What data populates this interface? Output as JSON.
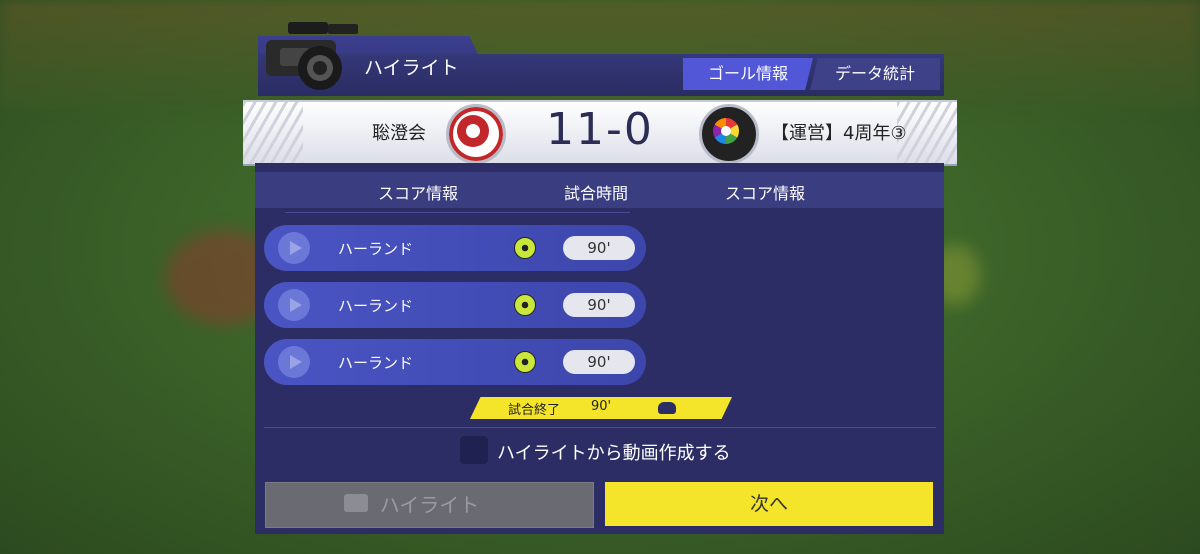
{
  "header": {
    "title": "ハイライト"
  },
  "tabs": [
    {
      "label": "ゴール情報",
      "active": true
    },
    {
      "label": "データ統計",
      "active": false
    }
  ],
  "match": {
    "home_team": "聡澄会",
    "score": "11-0",
    "away_team": "【運営】4周年③"
  },
  "columns": {
    "left": "スコア情報",
    "center": "試合時間",
    "right": "スコア情報"
  },
  "goals": [
    {
      "player": "ハーランド",
      "minute": "90'"
    },
    {
      "player": "ハーランド",
      "minute": "90'"
    },
    {
      "player": "ハーランド",
      "minute": "90'"
    }
  ],
  "final": {
    "label": "試合終了",
    "minute": "90'"
  },
  "option": {
    "label": "ハイライトから動画作成する",
    "checked": false
  },
  "buttons": {
    "highlight": "ハイライト",
    "next": "次へ"
  },
  "colors": {
    "accent_yellow": "#f5e52a",
    "panel": "#2b2d64",
    "tab_active": "#5157d6"
  }
}
